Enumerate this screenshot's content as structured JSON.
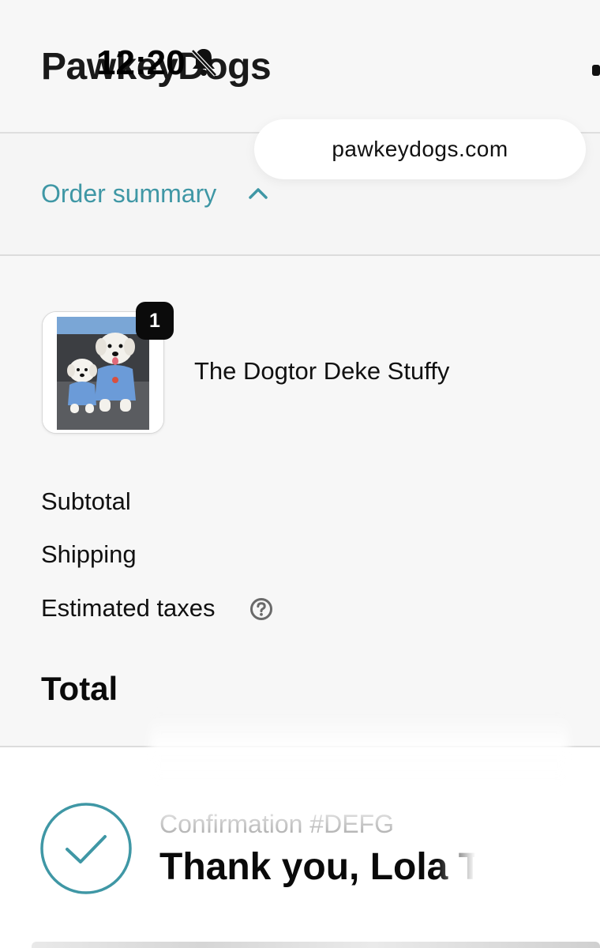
{
  "header": {
    "brand": "PawkeyDogs",
    "status_time": "12:20",
    "icons": [
      "bell-slash-icon"
    ]
  },
  "url_bar": {
    "url": "pawkeydogs.com"
  },
  "order_summary": {
    "toggle_label": "Order summary",
    "toggle_icon": "chevron-up-icon",
    "accent_color": "#3f97a5",
    "item": {
      "name": "The Dogtor Deke Stuffy",
      "quantity": "1",
      "image": "two-white-dogs-in-blue-shirts"
    },
    "rows": {
      "subtotal_label": "Subtotal",
      "shipping_label": "Shipping",
      "taxes_label": "Estimated taxes",
      "taxes_icon": "question-circle-icon",
      "total_label": "Total"
    }
  },
  "confirmation": {
    "subtitle": "Confirmation #DEFG",
    "heading": "Thank you, Lola T",
    "icon": "check-circle-icon"
  }
}
